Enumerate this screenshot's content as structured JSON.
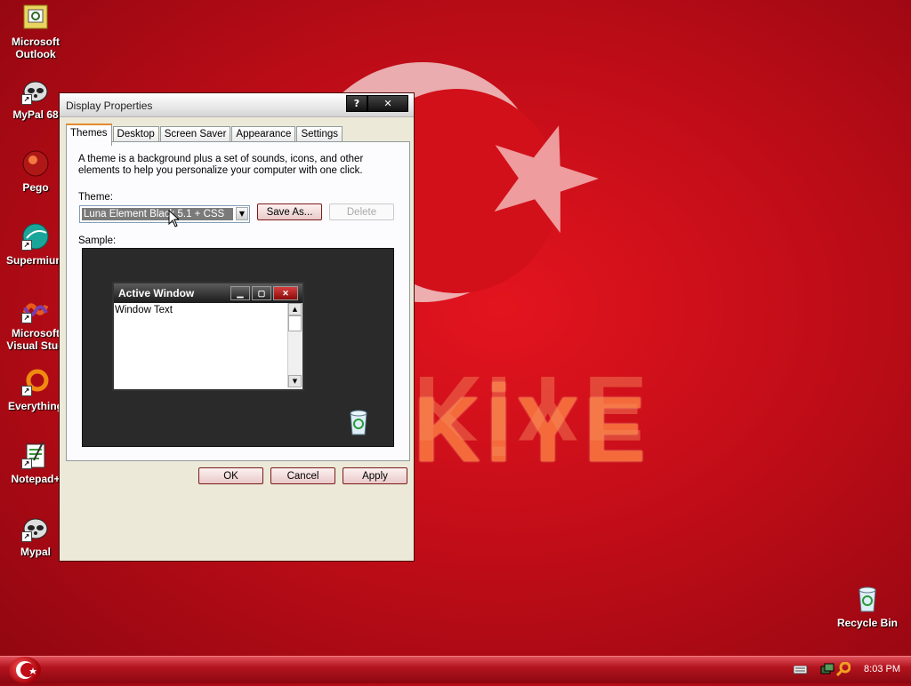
{
  "desktop": {
    "wallpaper_text": "KİYE",
    "icons": [
      {
        "label": "Microsoft Outlook",
        "icon": "outlook-icon"
      },
      {
        "label": "MyPal 68",
        "icon": "raccoon-icon"
      },
      {
        "label": "Pego",
        "icon": "pego-icon"
      },
      {
        "label": "Supermium",
        "icon": "supermium-icon"
      },
      {
        "label": "Microsoft Visual Stud",
        "icon": "visual-studio-icon"
      },
      {
        "label": "Everything",
        "icon": "everything-icon"
      },
      {
        "label": "Notepad+",
        "icon": "notepad-icon"
      },
      {
        "label": "Mypal",
        "icon": "raccoon-icon"
      },
      {
        "label": "Recycle Bin",
        "icon": "recycle-bin-icon"
      }
    ]
  },
  "window": {
    "title": "Display Properties",
    "help_btn": "?",
    "close_btn": "✕",
    "tabs": [
      {
        "label": "Themes",
        "active": true
      },
      {
        "label": "Desktop"
      },
      {
        "label": "Screen Saver"
      },
      {
        "label": "Appearance"
      },
      {
        "label": "Settings"
      }
    ],
    "description": "A theme is a background plus a set of sounds, icons, and other elements to help you personalize your computer with one click.",
    "theme_label": "Theme:",
    "theme_value": "Luna Element Black 5.1 + CSS",
    "save_as": "Save As...",
    "delete": "Delete",
    "sample_label": "Sample:",
    "sample": {
      "window_title": "Active Window",
      "window_text": "Window Text"
    },
    "ok": "OK",
    "cancel": "Cancel",
    "apply": "Apply"
  },
  "taskbar": {
    "clock": "8:03 PM"
  },
  "colors": {
    "wallpaper": "#c10d18",
    "taskbar": "#b2141e",
    "button_face": "#e9c9c9"
  }
}
